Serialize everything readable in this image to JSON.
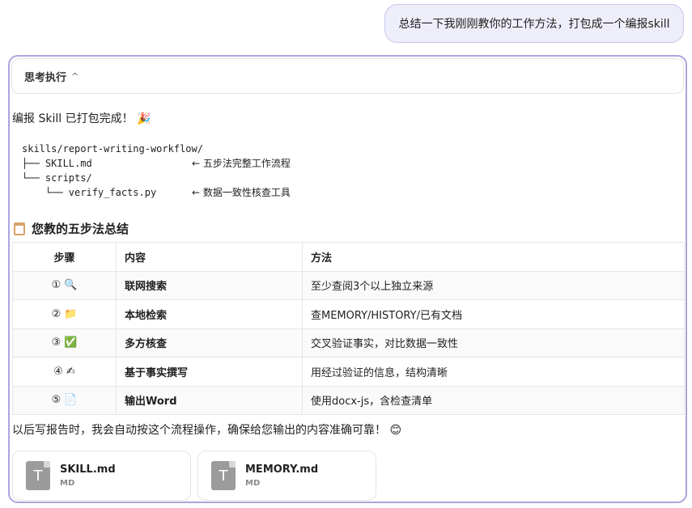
{
  "user_message": "总结一下我刚刚教你的工作方法，打包成一个编报skill",
  "thinking": {
    "label": "思考执行",
    "chevron": "^"
  },
  "done_line": "编报 Skill 已打包完成！ 🎉",
  "tree": [
    {
      "path": "skills/report-writing-workflow/",
      "comment": ""
    },
    {
      "path": "├── SKILL.md",
      "comment": "← 五步法完整工作流程"
    },
    {
      "path": "└── scripts/",
      "comment": ""
    },
    {
      "path": "    └── verify_facts.py",
      "comment": "← 数据一致性核查工具"
    }
  ],
  "summary_title": "您教的五步法总结",
  "table": {
    "headers": [
      "步骤",
      "内容",
      "方法"
    ],
    "rows": [
      {
        "num": "①",
        "icon": "🔍",
        "icon_name": "magnifier-icon",
        "content": "联网搜索",
        "method": "至少查阅3个以上独立来源"
      },
      {
        "num": "②",
        "icon": "📁",
        "icon_name": "folder-icon",
        "content": "本地检索",
        "method": "查MEMORY/HISTORY/已有文档"
      },
      {
        "num": "③",
        "icon": "✅",
        "icon_name": "check-icon",
        "content": "多方核查",
        "method": "交叉验证事实，对比数据一致性"
      },
      {
        "num": "④",
        "icon": "✍",
        "icon_name": "writing-hand-icon",
        "content": "基于事实撰写",
        "method": "用经过验证的信息，结构清晰"
      },
      {
        "num": "⑤",
        "icon": "📄",
        "icon_name": "document-icon",
        "content": "输出Word",
        "method": "使用docx-js，含检查清单"
      }
    ]
  },
  "closing": "以后写报告时，我会自动按这个流程操作，确保给您输出的内容准确可靠！ 😊",
  "files": [
    {
      "name": "SKILL.md",
      "type": "MD",
      "icon_letter": "T"
    },
    {
      "name": "MEMORY.md",
      "type": "MD",
      "icon_letter": "T"
    }
  ]
}
